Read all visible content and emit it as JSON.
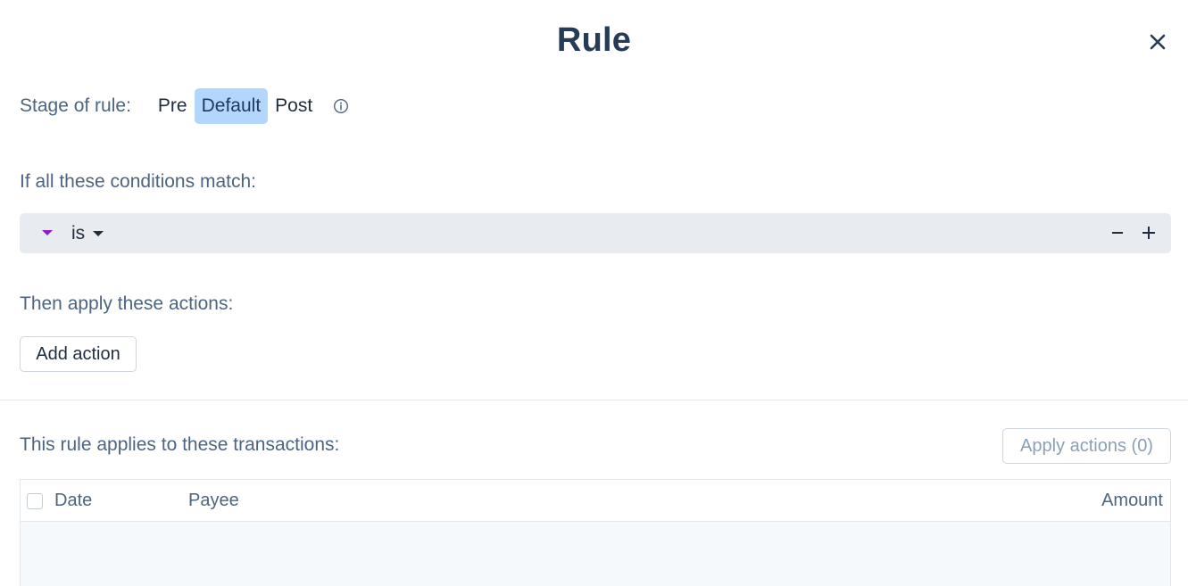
{
  "modal": {
    "title": "Rule"
  },
  "stage": {
    "label": "Stage of rule:",
    "options": [
      "Pre",
      "Default",
      "Post"
    ],
    "selected": "Default"
  },
  "conditions": {
    "label": "If all these conditions match:",
    "rows": [
      {
        "field": "",
        "operator": "is",
        "value": ""
      }
    ]
  },
  "actions": {
    "label": "Then apply these actions:",
    "add_button": "Add action"
  },
  "transactions": {
    "label": "This rule applies to these transactions:",
    "apply_button": "Apply actions (0)",
    "columns": [
      "Date",
      "Payee",
      "Amount"
    ],
    "rows": []
  },
  "colors": {
    "title": "#263b55",
    "selected_stage_bg": "#b3d6fd",
    "condition_row_bg": "#e8ebf0",
    "field_caret": "#8a1fc4",
    "muted_text": "#4d6580",
    "table_body_bg": "#f6f9fc"
  }
}
